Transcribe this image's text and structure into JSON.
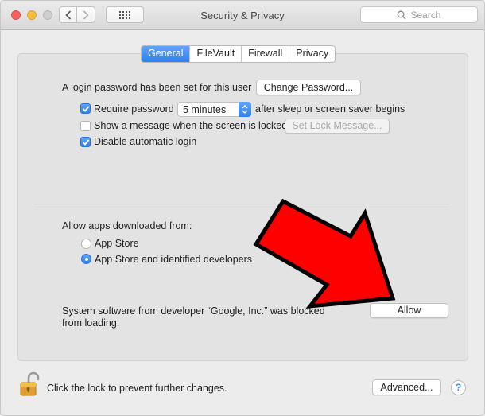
{
  "window": {
    "title": "Security & Privacy",
    "search_placeholder": "Search"
  },
  "tabs": [
    {
      "label": "General",
      "active": true
    },
    {
      "label": "FileVault",
      "active": false
    },
    {
      "label": "Firewall",
      "active": false
    },
    {
      "label": "Privacy",
      "active": false
    }
  ],
  "general": {
    "login_password_text": "A login password has been set for this user",
    "change_password_label": "Change Password...",
    "require_password": {
      "label": "Require password",
      "checked": true
    },
    "password_delay": {
      "value": "5 minutes"
    },
    "after_sleep_text": "after sleep or screen saver begins",
    "show_message": {
      "label": "Show a message when the screen is locked",
      "checked": false
    },
    "set_lock_message_label": "Set Lock Message...",
    "disable_auto_login": {
      "label": "Disable automatic login",
      "checked": true
    }
  },
  "apps": {
    "heading": "Allow apps downloaded from:",
    "options": [
      {
        "label": "App Store",
        "selected": false
      },
      {
        "label": "App Store and identified developers",
        "selected": true
      }
    ]
  },
  "blocked": {
    "line1": "System software from developer “Google, Inc.” was blocked",
    "line2": "from loading.",
    "allow_label": "Allow"
  },
  "footer": {
    "lock_text": "Click the lock to prevent further changes.",
    "advanced_label": "Advanced...",
    "help_label": "?"
  },
  "annotation": {
    "color": "#ff0000",
    "outline": "#000000"
  },
  "colors": {
    "accent": "#2d81f0"
  }
}
